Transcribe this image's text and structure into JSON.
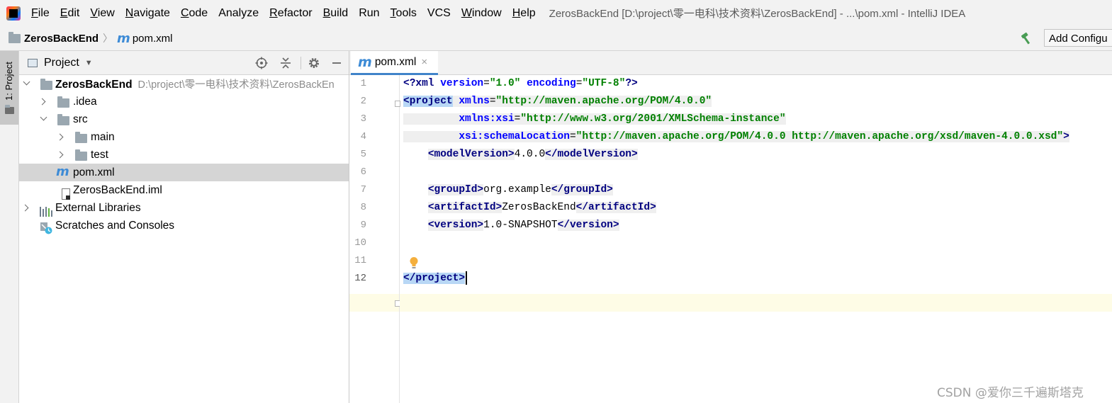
{
  "menubar": {
    "items": [
      {
        "label": "File",
        "mnemonic": "F",
        "rest": "ile"
      },
      {
        "label": "Edit",
        "mnemonic": "E",
        "rest": "dit"
      },
      {
        "label": "View",
        "mnemonic": "V",
        "rest": "iew"
      },
      {
        "label": "Navigate",
        "mnemonic": "N",
        "rest": "avigate"
      },
      {
        "label": "Code",
        "mnemonic": "C",
        "rest": "ode"
      },
      {
        "label": "Analyze",
        "mnemonic": "",
        "rest": "Analyze"
      },
      {
        "label": "Refactor",
        "mnemonic": "R",
        "rest": "efactor"
      },
      {
        "label": "Build",
        "mnemonic": "B",
        "rest": "uild"
      },
      {
        "label": "Run",
        "mnemonic": "",
        "rest": "Run"
      },
      {
        "label": "Tools",
        "mnemonic": "T",
        "rest": "ools"
      },
      {
        "label": "VCS",
        "mnemonic": "",
        "rest": "VCS"
      },
      {
        "label": "Window",
        "mnemonic": "W",
        "rest": "indow"
      },
      {
        "label": "Help",
        "mnemonic": "H",
        "rest": "elp"
      }
    ],
    "window_title": "ZerosBackEnd [D:\\project\\零一电科\\技术资料\\ZerosBackEnd] - ...\\pom.xml - IntelliJ IDEA"
  },
  "navbar": {
    "root": "ZerosBackEnd",
    "separator": "〉",
    "file": "pom.xml",
    "maven_icon": "m",
    "add_config_label": "Add Configu"
  },
  "left_stripe": {
    "label": "1: Project"
  },
  "project_panel": {
    "title": "Project",
    "tree": {
      "root_label": "ZerosBackEnd",
      "root_path": "D:\\project\\零一电科\\技术资料\\ZerosBackEn",
      "idea": ".idea",
      "src": "src",
      "main": "main",
      "test": "test",
      "pom": "pom.xml",
      "iml": "ZerosBackEnd.iml",
      "external": "External Libraries",
      "scratches": "Scratches and Consoles"
    }
  },
  "editor": {
    "tab_label": "pom.xml",
    "tab_close": "×",
    "line_numbers": [
      "1",
      "2",
      "3",
      "4",
      "5",
      "6",
      "7",
      "8",
      "9",
      "10",
      "11",
      "12"
    ],
    "current_line": 12,
    "code": {
      "l1_open": "<?",
      "l1_tag": "xml",
      "l1_a1": "version",
      "l1_v1": "\"1.0\"",
      "l1_a2": "encoding",
      "l1_v2": "\"UTF-8\"",
      "l1_close": "?>",
      "l2_tag": "<project",
      "l2_a1": "xmlns",
      "l2_v1": "\"http://maven.apache.org/POM/4.0.0\"",
      "l3_a1": "xmlns:xsi",
      "l3_v1": "\"http://www.w3.org/2001/XMLSchema-instance\"",
      "l4_a1": "xsi:schemaLocation",
      "l4_v1": "\"http://maven.apache.org/POM/4.0.0 http://maven.apache.org/xsd/maven-4.0.0.xsd\"",
      "l4_close": ">",
      "l5_open": "<modelVersion>",
      "l5_val": "4.0.0",
      "l5_close": "</modelVersion>",
      "l7_open": "<groupId>",
      "l7_val": "org.example",
      "l7_close": "</groupId>",
      "l8_open": "<artifactId>",
      "l8_val": "ZerosBackEnd",
      "l8_close": "</artifactId>",
      "l9_open": "<version>",
      "l9_val": "1.0-SNAPSHOT",
      "l9_close": "</version>",
      "l12_tag": "</project>"
    }
  },
  "watermark": "CSDN @爱你三千遍斯塔克",
  "colors": {
    "xml_tag": "#000080",
    "xml_attr_name": "#0000ff",
    "xml_attr_value": "#008000",
    "tab_underline": "#4083c9",
    "current_line_bg": "#fefce6",
    "tag_match_bg": "#b8d7f5"
  }
}
